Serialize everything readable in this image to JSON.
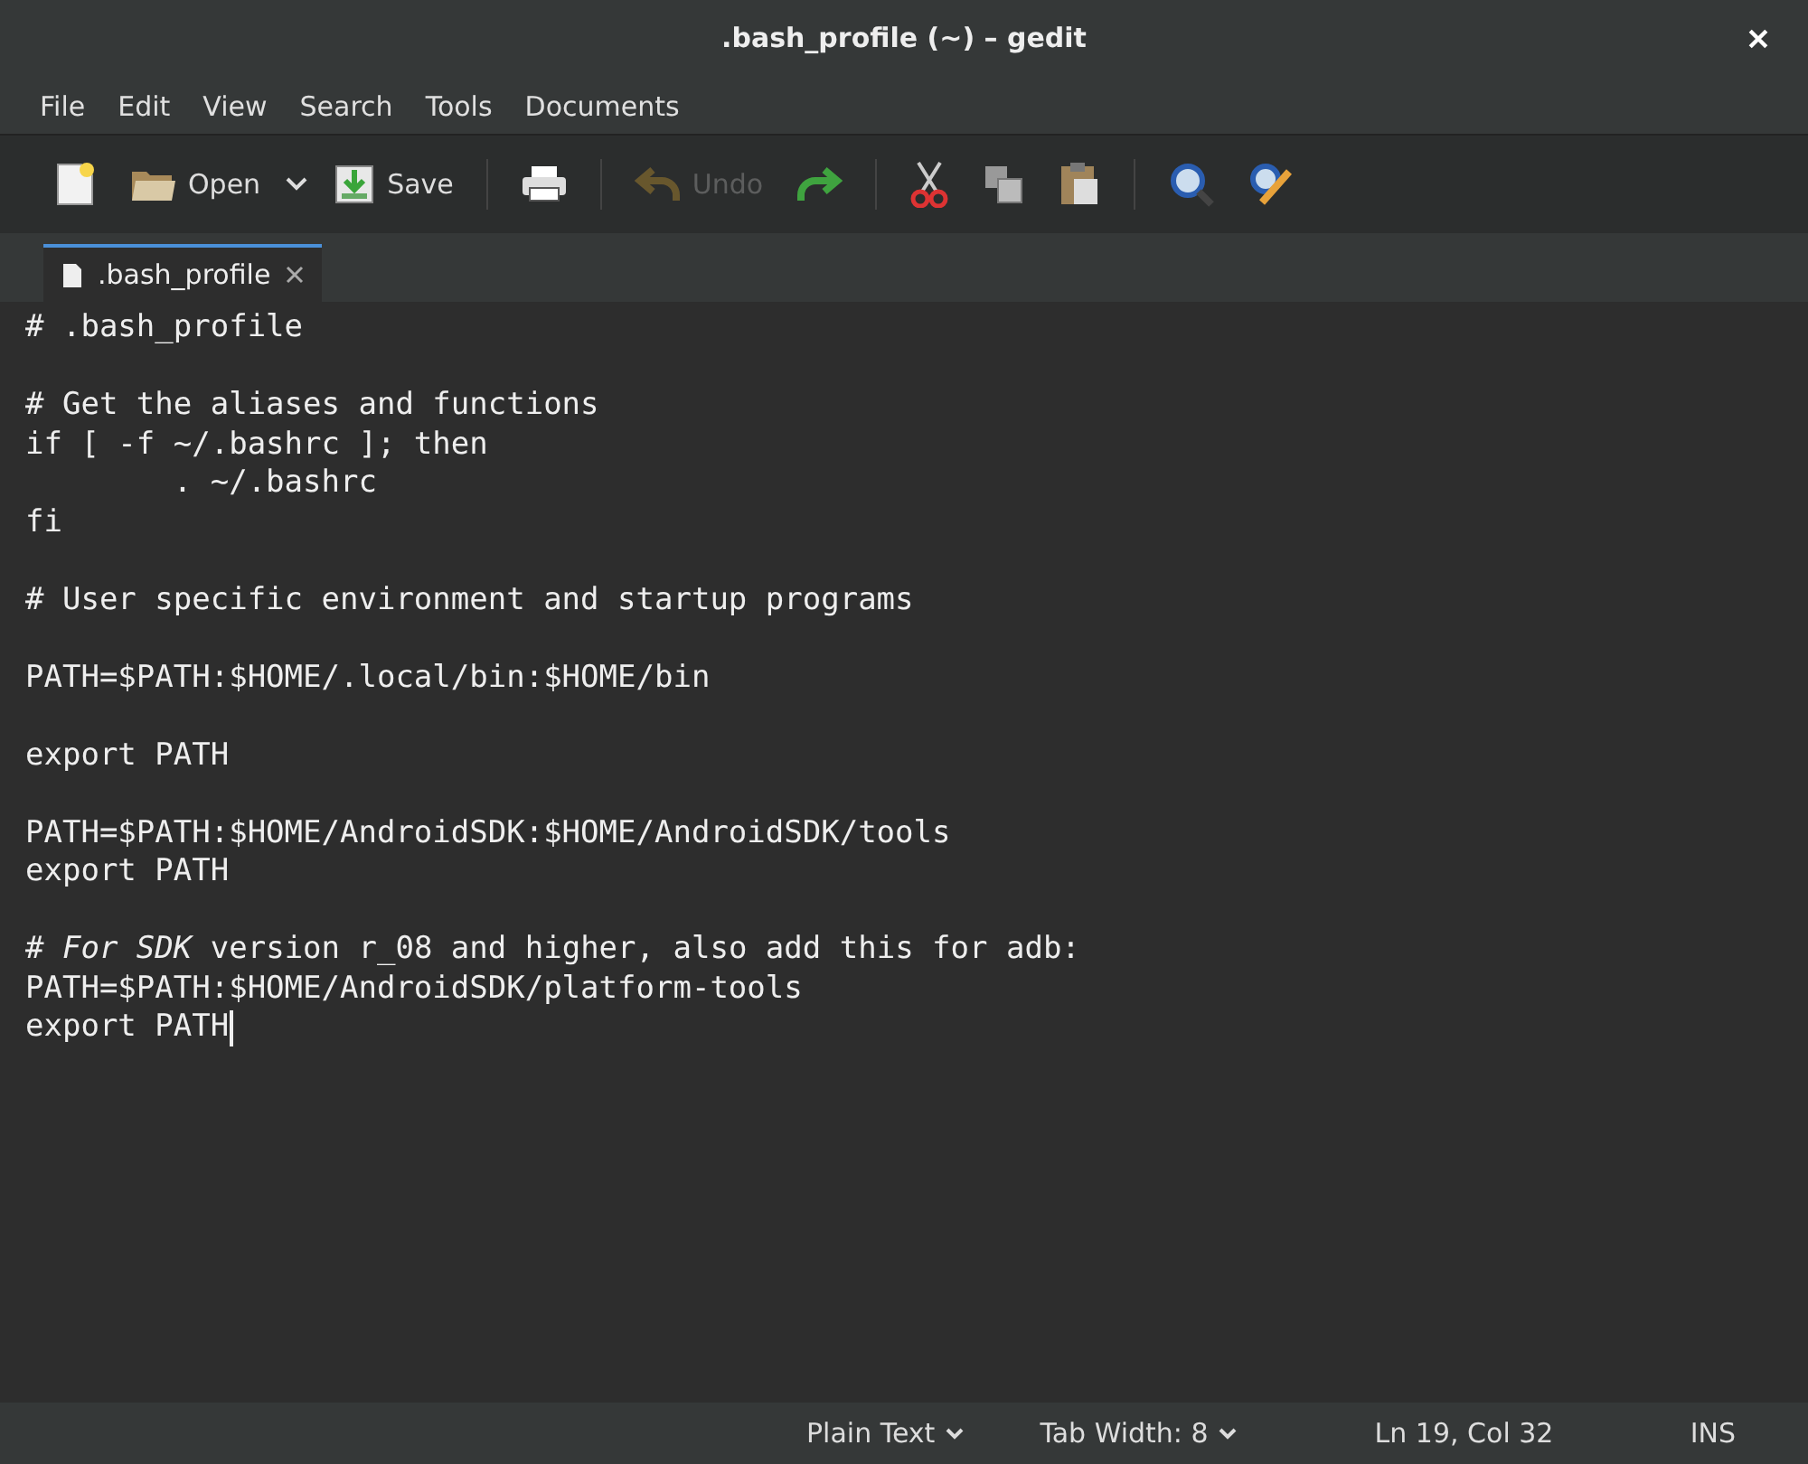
{
  "window": {
    "title": ".bash_profile (~) – gedit"
  },
  "menu": [
    "File",
    "Edit",
    "View",
    "Search",
    "Tools",
    "Documents"
  ],
  "toolbar": [
    {
      "kind": "button",
      "disabled": false
    },
    {
      "kind": "button",
      "label": "Open",
      "disabled": false
    },
    {
      "kind": "dropdown",
      "disabled": false
    },
    {
      "kind": "button",
      "label": "Save",
      "disabled": false
    },
    {
      "kind": "separator"
    },
    {
      "kind": "button",
      "disabled": false
    },
    {
      "kind": "separator"
    },
    {
      "kind": "button",
      "label": "Undo",
      "disabled": true
    },
    {
      "kind": "button",
      "disabled": false
    },
    {
      "kind": "separator"
    },
    {
      "kind": "button",
      "disabled": false
    },
    {
      "kind": "button",
      "disabled": false
    },
    {
      "kind": "button",
      "disabled": false
    },
    {
      "kind": "separator"
    },
    {
      "kind": "button",
      "disabled": false
    },
    {
      "kind": "button",
      "disabled": false
    }
  ],
  "tabs": [
    {
      "label": ".bash_profile",
      "selected": true
    }
  ],
  "editor": {
    "blocks": [
      [
        "# .bash_profile"
      ],
      [
        "# Get the aliases and functions",
        "if [ -f ~/.bashrc ]; then",
        "        . ~/.bashrc",
        "fi"
      ],
      [
        "# User specific environment and startup programs"
      ],
      [
        "PATH=$PATH:$HOME/.local/bin:$HOME/bin"
      ],
      [
        "export PATH"
      ],
      [
        "PATH=$PATH:$HOME/AndroidSDK:$HOME/AndroidSDK/tools",
        "export PATH"
      ],
      [
        "# *For SDK* version r_08 and higher, also add this for adb:",
        "PATH=$PATH:$HOME/AndroidSDK/platform-tools",
        "export PATH"
      ]
    ]
  },
  "status_bar": {
    "language": "Plain Text",
    "tab_width": "Tab Width: 8",
    "position": "Ln 19, Col 32",
    "mode": "INS"
  }
}
